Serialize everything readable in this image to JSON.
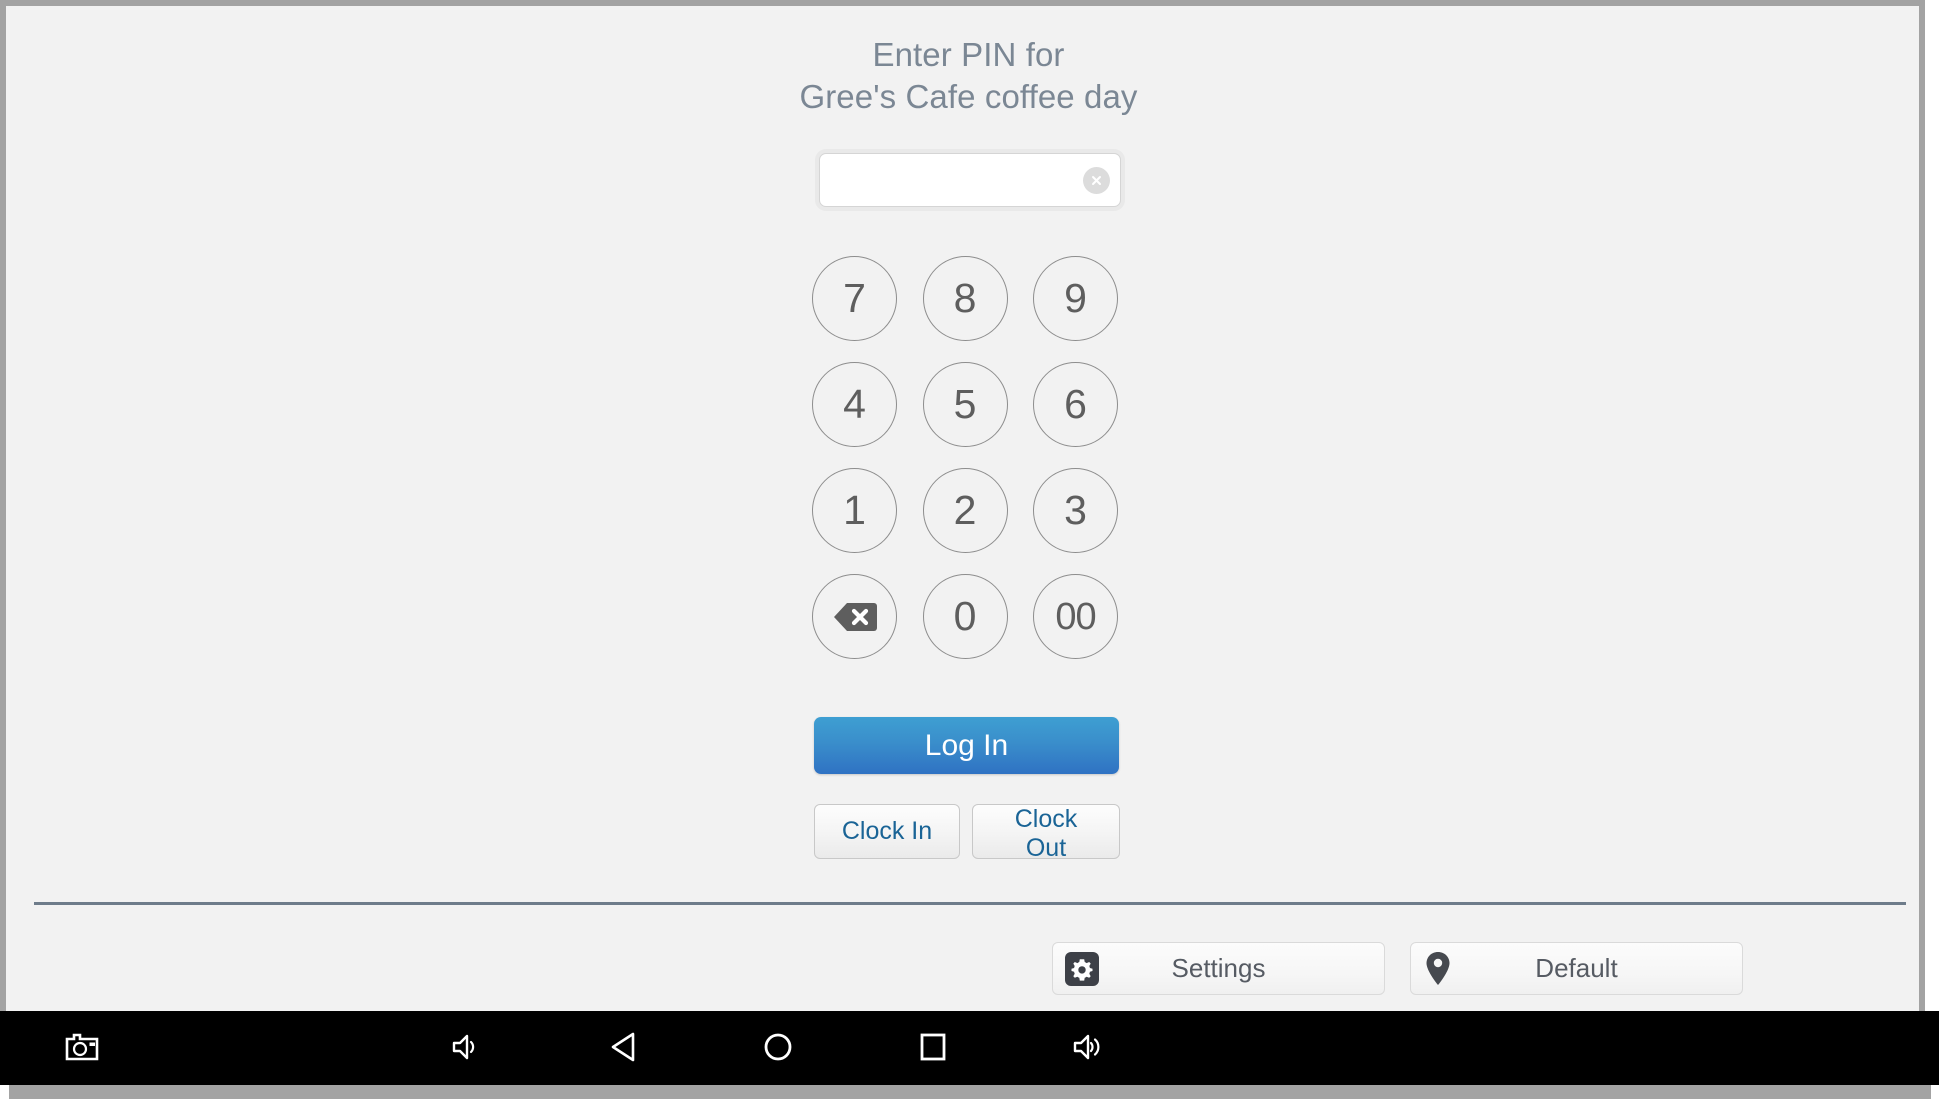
{
  "screen": {
    "title_line1": "Enter PIN for",
    "title_line2": "Gree's Cafe coffee day",
    "background_color": "#f2f2f2",
    "title_color": "#7b8794"
  },
  "pin_input": {
    "value": "",
    "placeholder": "",
    "clear_icon": "clear-circle-x-icon"
  },
  "keypad": {
    "rows": [
      [
        {
          "label": "7",
          "name": "key-7",
          "type": "digit"
        },
        {
          "label": "8",
          "name": "key-8",
          "type": "digit"
        },
        {
          "label": "9",
          "name": "key-9",
          "type": "digit"
        }
      ],
      [
        {
          "label": "4",
          "name": "key-4",
          "type": "digit"
        },
        {
          "label": "5",
          "name": "key-5",
          "type": "digit"
        },
        {
          "label": "6",
          "name": "key-6",
          "type": "digit"
        }
      ],
      [
        {
          "label": "1",
          "name": "key-1",
          "type": "digit"
        },
        {
          "label": "2",
          "name": "key-2",
          "type": "digit"
        },
        {
          "label": "3",
          "name": "key-3",
          "type": "digit"
        }
      ],
      [
        {
          "label": "",
          "name": "key-backspace",
          "type": "backspace",
          "icon": "backspace-icon"
        },
        {
          "label": "0",
          "name": "key-0",
          "type": "digit"
        },
        {
          "label": "00",
          "name": "key-00",
          "type": "digit"
        }
      ]
    ],
    "key_border_color": "#8d8d8d",
    "key_text_color": "#5e5e5e"
  },
  "actions": {
    "login_label": "Log In",
    "login_color": "#3a8ecb",
    "clock_in_label": "Clock In",
    "clock_out_label": "Clock Out",
    "clock_text_color": "#1a6496"
  },
  "footer": {
    "settings_label": "Settings",
    "settings_icon": "gear-icon",
    "location_label": "Default",
    "location_icon": "map-pin-icon",
    "divider_color": "#6e7c8a"
  },
  "navbar": {
    "background_color": "#000000",
    "items": [
      {
        "name": "nav-screenshot",
        "icon": "camera-icon"
      },
      {
        "name": "nav-volume-down",
        "icon": "volume-down-icon"
      },
      {
        "name": "nav-back",
        "icon": "back-triangle-icon"
      },
      {
        "name": "nav-home",
        "icon": "home-circle-icon"
      },
      {
        "name": "nav-recents",
        "icon": "recents-square-icon"
      },
      {
        "name": "nav-volume-up",
        "icon": "volume-up-icon"
      }
    ]
  }
}
